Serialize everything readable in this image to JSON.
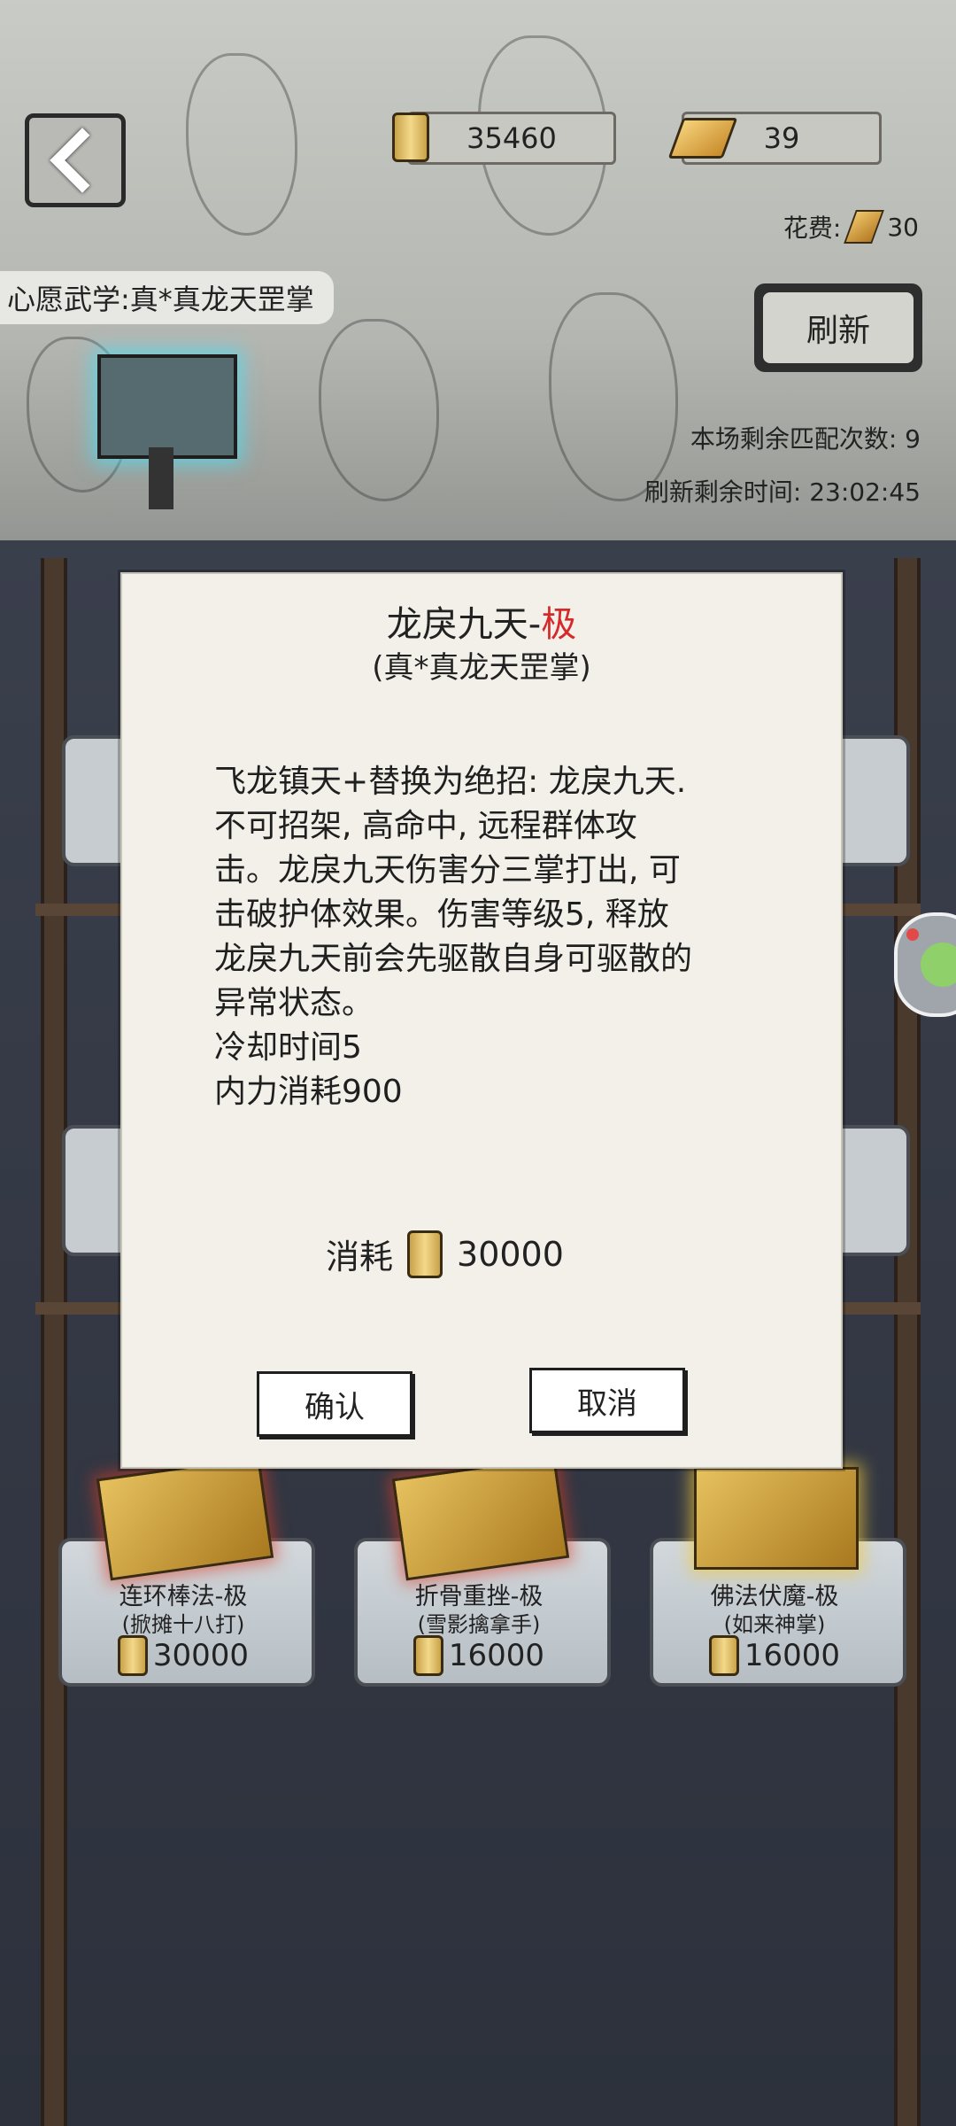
{
  "header": {
    "back_icon": "chevron-left-icon",
    "currency_scroll": "35460",
    "currency_ingot": "39",
    "spend_label": "花费:",
    "spend_value": "30"
  },
  "wish": {
    "label": "心愿武学:真*真龙天罡掌"
  },
  "refresh": {
    "label": "刷新"
  },
  "match_info": {
    "remaining_matches": "本场剩余匹配次数: 9",
    "refresh_time": "刷新剩余时间: 23:02:45"
  },
  "shop_items": [
    {
      "name": "连环棒法-极",
      "sub": "(掀摊十八打)",
      "price": "30000"
    },
    {
      "name": "折骨重挫-极",
      "sub": "(雪影擒拿手)",
      "price": "16000"
    },
    {
      "name": "佛法伏魔-极",
      "sub": "(如来神掌)",
      "price": "16000"
    }
  ],
  "modal": {
    "title": "龙戾九天-",
    "grade": "极",
    "subtitle": "(真*真龙天罡掌)",
    "description_lines": [
      "飞龙镇天+替换为绝招: 龙戾九天.",
      "不可招架, 高命中, 远程群体攻",
      "击。龙戾九天伤害分三掌打出, 可",
      "击破护体效果。伤害等级5, 释放",
      "龙戾九天前会先驱散自身可驱散的",
      "异常状态。",
      "冷却时间5",
      "内力消耗900"
    ],
    "cost_label": "消耗",
    "cost_value": "30000",
    "confirm_label": "确认",
    "cancel_label": "取消"
  },
  "colors": {
    "grade_red": "#d52a2a",
    "panel": "#f2f0e9"
  }
}
